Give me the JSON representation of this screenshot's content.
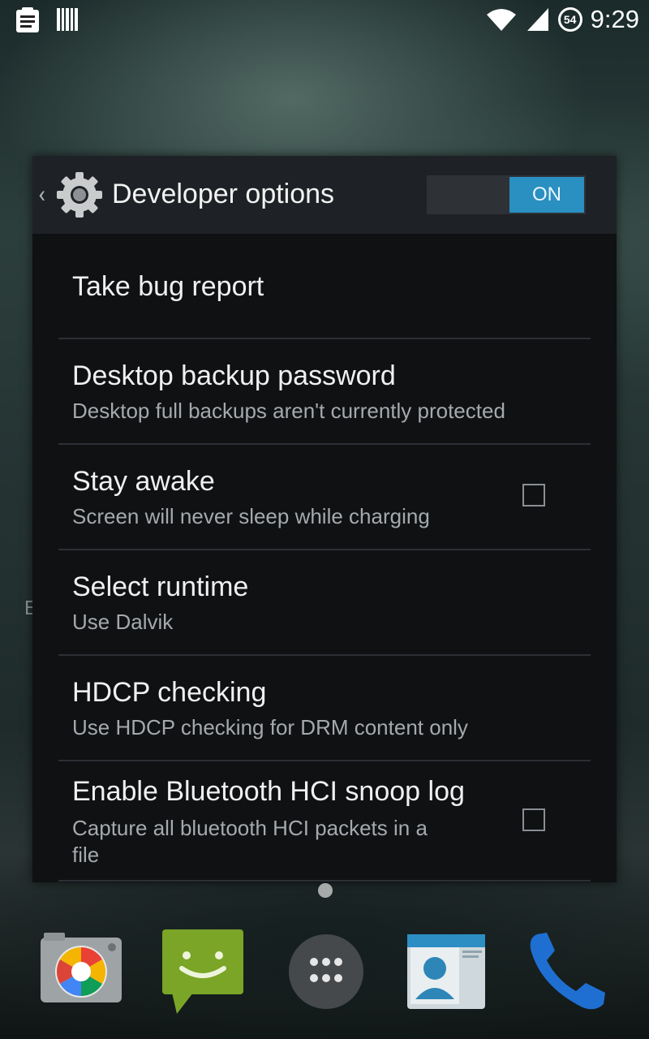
{
  "status_bar": {
    "time": "9:29",
    "battery_level": "54",
    "icons": [
      "clipboard-icon",
      "barcode-icon",
      "wifi-icon",
      "signal-icon",
      "battery-icon"
    ]
  },
  "background": {
    "side_text": "E"
  },
  "dialog": {
    "back_glyph": "‹",
    "title": "Developer options",
    "toggle_label": "ON",
    "accent_color": "#2a8fc1",
    "items": [
      {
        "title": "Take bug report",
        "summary": ""
      },
      {
        "title": "Desktop backup password",
        "summary": "Desktop full backups aren't currently protected"
      },
      {
        "title": "Stay awake",
        "summary": "Screen will never sleep while charging",
        "checked": false
      },
      {
        "title": "Select runtime",
        "summary": "Use Dalvik"
      },
      {
        "title": "HDCP checking",
        "summary": "Use HDCP checking for DRM content only"
      },
      {
        "title": "Enable Bluetooth HCI snoop log",
        "summary_line1": "Capture all bluetooth HCI packets in a",
        "summary_line2": "file",
        "checked": false
      }
    ]
  },
  "dock": {
    "apps": [
      "camera-icon",
      "messaging-icon",
      "app-drawer-icon",
      "contacts-icon",
      "phone-icon"
    ]
  }
}
